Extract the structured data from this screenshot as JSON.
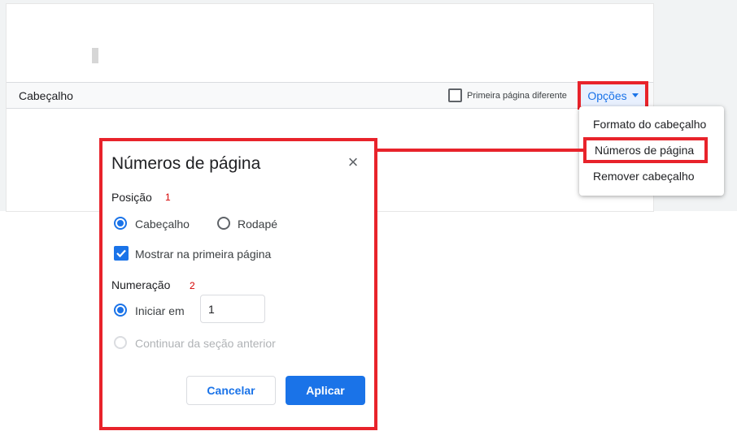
{
  "header_bar": {
    "label": "Cabeçalho",
    "first_page_checkbox_label": "Primeira página diferente",
    "options_button_label": "Opções"
  },
  "options_menu": {
    "items": [
      {
        "label": "Formato do cabeçalho"
      },
      {
        "label": "Números de página",
        "highlighted": true
      },
      {
        "label": "Remover cabeçalho"
      }
    ]
  },
  "dialog": {
    "title": "Números de página",
    "position_section": {
      "label": "Posição",
      "annotation": "1",
      "options": [
        {
          "label": "Cabeçalho",
          "selected": true
        },
        {
          "label": "Rodapé",
          "selected": false
        }
      ],
      "show_first_page": {
        "label": "Mostrar na primeira página",
        "checked": true
      }
    },
    "numbering_section": {
      "label": "Numeração",
      "annotation": "2",
      "start_at": {
        "label": "Iniciar em",
        "selected": true,
        "value": "1"
      },
      "continue": {
        "label": "Continuar da seção anterior",
        "disabled": true
      }
    },
    "buttons": {
      "cancel": "Cancelar",
      "apply": "Aplicar"
    }
  },
  "colors": {
    "accent": "#1a73e8",
    "highlight_red": "#e8232b"
  }
}
